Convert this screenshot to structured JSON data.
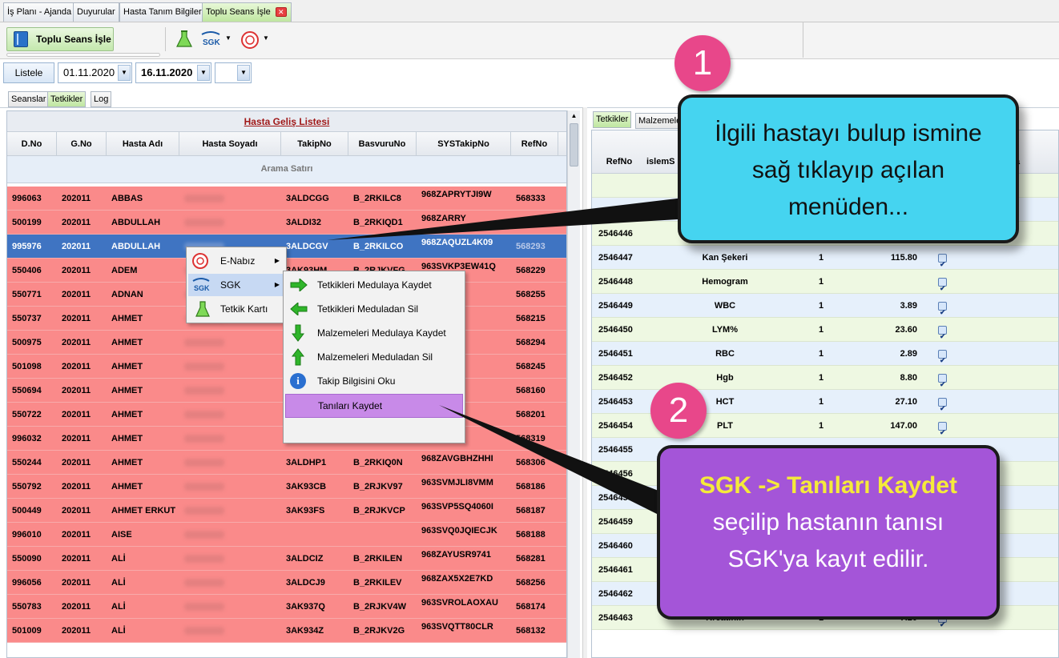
{
  "doc_tabs": [
    "İş Planı - Ajanda",
    "Duyurular",
    "Hasta Tanım Bilgileri",
    "Toplu Seans İşle"
  ],
  "toolbar": {
    "main_button": "Toplu Seans İşle",
    "sgk_label": "SGK"
  },
  "filters": {
    "list_button": "Listele",
    "date_from": "01.11.2020",
    "date_to": "16.11.2020",
    "empty_combo": ""
  },
  "left_tabs": [
    "Seanslar",
    "Tetkikler",
    "Log"
  ],
  "grid": {
    "title": "Hasta Geliş Listesi",
    "columns": [
      "D.No",
      "G.No",
      "Hasta Adı",
      "Hasta Soyadı",
      "TakipNo",
      "BasvuruNo",
      "SYSTakipNo",
      "RefNo"
    ],
    "search_row": "Arama Satırı",
    "rows": [
      [
        "996063",
        "202011",
        "ABBAS",
        "",
        "3ALDCGG",
        "B_2RKILC8",
        "968ZAPRYTJI9W",
        "568333"
      ],
      [
        "500199",
        "202011",
        "ABDULLAH",
        "",
        "3ALDI32",
        "B_2RKIQD1",
        "968ZARRY",
        "568"
      ],
      [
        "995976",
        "202011",
        "ABDULLAH",
        "",
        "3ALDCGV",
        "B_2RKILCO",
        "968ZAQUZL4K09",
        "568293"
      ],
      [
        "550406",
        "202011",
        "ADEM",
        "",
        "3AK93HM",
        "B_2RJKVFG",
        "963SVKP3EW41Q",
        "568229"
      ],
      [
        "550771",
        "202011",
        "ADNAN",
        "",
        "",
        "",
        "7DS6G",
        "568255"
      ],
      [
        "550737",
        "202011",
        "AHMET",
        "",
        "",
        "",
        "SVDN",
        "568215"
      ],
      [
        "500975",
        "202011",
        "AHMET",
        "",
        "",
        "",
        "D8XEG",
        "568294"
      ],
      [
        "501098",
        "202011",
        "AHMET",
        "",
        "",
        "",
        "P3XK9",
        "568245"
      ],
      [
        "550694",
        "202011",
        "AHMET",
        "",
        "",
        "",
        "K8G8R",
        "568160"
      ],
      [
        "550722",
        "202011",
        "AHMET",
        "",
        "",
        "",
        "NM10S",
        "568201"
      ],
      [
        "996032",
        "202011",
        "AHMET",
        "",
        "",
        "",
        "NKW9",
        "568319"
      ],
      [
        "550244",
        "202011",
        "AHMET",
        "",
        "3ALDHP1",
        "B_2RKIQ0N",
        "968ZAVGBHZHHI",
        "568306"
      ],
      [
        "550792",
        "202011",
        "AHMET",
        "",
        "3AK93CB",
        "B_2RJKV97",
        "963SVMJLI8VMM",
        "568186"
      ],
      [
        "500449",
        "202011",
        "AHMET ERKUT",
        "",
        "3AK93FS",
        "B_2RJKVCP",
        "963SVP5SQ4060I",
        "568187"
      ],
      [
        "996010",
        "202011",
        "AISE",
        "",
        "",
        "",
        "963SVQ0JQIECJK",
        "568188"
      ],
      [
        "550090",
        "202011",
        "ALİ",
        "",
        "3ALDCIZ",
        "B_2RKILEN",
        "968ZAYUSR9741",
        "568281"
      ],
      [
        "996056",
        "202011",
        "ALİ",
        "",
        "3ALDCJ9",
        "B_2RKILEV",
        "968ZAX5X2E7KD",
        "568256"
      ],
      [
        "550783",
        "202011",
        "ALİ",
        "",
        "3AK937Q",
        "B_2RJKV4W",
        "963SVROLAOXAU",
        "568174"
      ],
      [
        "501009",
        "202011",
        "ALİ",
        "",
        "3AK934Z",
        "B_2RJKV2G",
        "963SVQTT80CLR",
        "568132"
      ]
    ]
  },
  "right_tabs": [
    "Tetkikler",
    "Malzemele"
  ],
  "right_grid": {
    "columns": [
      "RefNo",
      "islemS",
      "",
      "",
      "",
      "a"
    ],
    "rows": [
      [
        "2546446",
        "",
        "",
        "",
        ""
      ],
      [
        "2546447",
        "Kan Şekeri",
        "1",
        "115.80",
        "x"
      ],
      [
        "2546448",
        "Hemogram",
        "1",
        "",
        "x"
      ],
      [
        "2546449",
        "WBC",
        "1",
        "3.89",
        "x"
      ],
      [
        "2546450",
        "LYM%",
        "1",
        "23.60",
        "x"
      ],
      [
        "2546451",
        "RBC",
        "1",
        "2.89",
        "x"
      ],
      [
        "2546452",
        "Hgb",
        "1",
        "8.80",
        "x"
      ],
      [
        "2546453",
        "HCT",
        "1",
        "27.10",
        "x"
      ],
      [
        "2546454",
        "PLT",
        "1",
        "147.00",
        "x"
      ],
      [
        "2546455",
        "",
        "",
        "",
        ""
      ],
      [
        "2546456",
        "",
        "",
        "",
        ""
      ],
      [
        "2546458",
        "",
        "",
        "",
        ""
      ],
      [
        "2546459",
        "",
        "",
        "",
        ""
      ],
      [
        "2546460",
        "",
        "",
        "",
        ""
      ],
      [
        "2546461",
        "",
        "",
        "",
        ""
      ],
      [
        "2546462",
        "",
        "",
        "",
        ""
      ],
      [
        "2546463",
        "Kreatinin",
        "1",
        "7.20",
        "x"
      ]
    ]
  },
  "context_menu": {
    "items": [
      "E-Nabız",
      "SGK",
      "Tetkik Kartı"
    ]
  },
  "sgk_submenu": {
    "items": [
      "Tetkikleri Medulaya Kaydet",
      "Tetkikleri Meduladan Sil",
      "Malzemeleri Medulaya Kaydet",
      "Malzemeleri Meduladan Sil",
      "Takip Bilgisini Oku",
      "Tanıları Kaydet"
    ]
  },
  "callout1": {
    "badge": "1",
    "text": "İlgili hastayı bulup ismine sağ tıklayıp açılan menüden..."
  },
  "callout2": {
    "badge": "2",
    "highlight": "SGK -> Tanıları Kaydet",
    "text": "seçilip hastanın tanısı SGK'ya kayıt edilir."
  },
  "colors": {
    "row_red": "#fa8a8a",
    "row_selected": "#3f74c2",
    "callout1_bg": "#45d4f0",
    "callout2_bg": "#a455d8",
    "badge": "#e8478a",
    "highlight_text": "#f5ea3a"
  }
}
